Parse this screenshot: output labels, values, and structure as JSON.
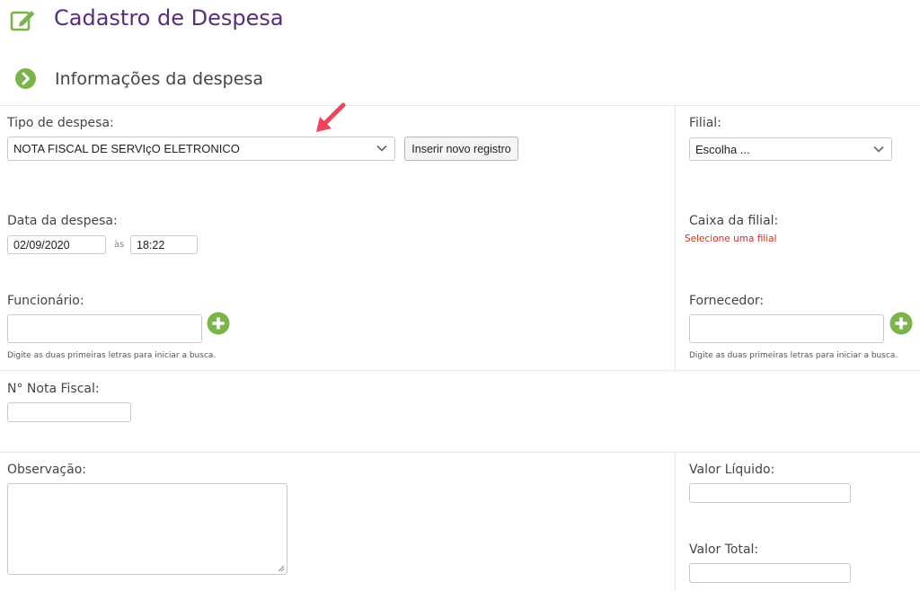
{
  "header": {
    "title": "Cadastro de Despesa",
    "section_title": "Informações da despesa"
  },
  "colors": {
    "title": "#5a2d7a",
    "accent_green": "#7bb44a",
    "error": "#e0261b",
    "annotation_arrow": "#f2435a"
  },
  "icons": {
    "edit": "edit-icon",
    "section": "chevron-right-circle-icon",
    "add": "plus-circle-icon",
    "dropdown": "chevron-down-icon"
  },
  "form": {
    "tipo": {
      "label": "Tipo de despesa:",
      "value": "NOTA FISCAL DE SERVIçO ELETRONICO",
      "insert_button": "Inserir novo registro"
    },
    "filial": {
      "label": "Filial:",
      "value": "Escolha ..."
    },
    "data": {
      "label": "Data da despesa:",
      "date": "02/09/2020",
      "sep": "às",
      "time": "18:22"
    },
    "caixa": {
      "label": "Caixa da filial:",
      "message": "Selecione uma filial"
    },
    "funcionario": {
      "label": "Funcionário:",
      "value": "",
      "hint": "Digite as duas primeiras letras para iniciar a busca."
    },
    "fornecedor": {
      "label": "Fornecedor:",
      "value": "",
      "hint": "Digite as duas primeiras letras para iniciar a busca."
    },
    "nota": {
      "label": "N° Nota Fiscal:",
      "value": ""
    },
    "observacao": {
      "label": "Observação:",
      "value": ""
    },
    "valor_liquido": {
      "label": "Valor Líquido:",
      "value": ""
    },
    "valor_total": {
      "label": "Valor Total:",
      "value": ""
    }
  }
}
